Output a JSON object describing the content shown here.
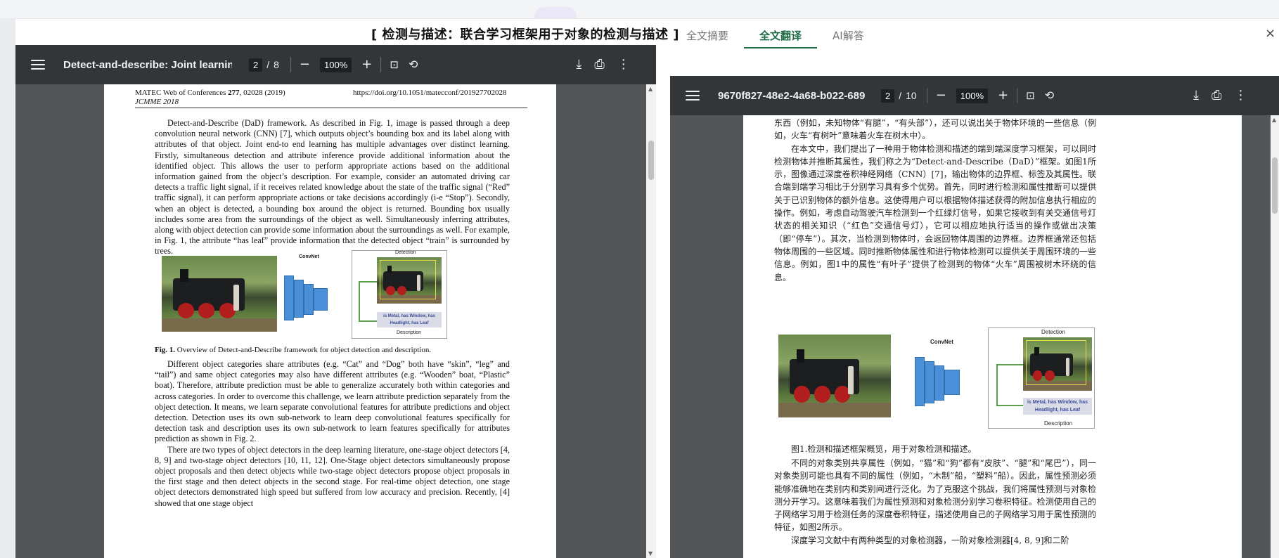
{
  "modal": {
    "title": "[ 检测与描述：联合学习框架用于对象的检测与描述 ]",
    "close": "×"
  },
  "left_viewer": {
    "doc_title": "Detect-and-describe: Joint learning...",
    "page_current": "2",
    "page_separator": "/",
    "page_total": "8",
    "zoom": "100%",
    "icons": [
      "menu-icon",
      "zoom-out-icon",
      "zoom-in-icon",
      "fit-page-icon",
      "rotate-icon",
      "download-icon",
      "print-icon",
      "more-icon"
    ],
    "page": {
      "header_left_pre": "MATEC Web of Conferences ",
      "header_left_bold": "277",
      "header_left_post": ", 02028 (2019)",
      "header_right": "https://doi.org/10.1051/matecconf/201927702028",
      "header_conf": "JCMME 2018",
      "paragraphs": [
        "Detect-and-Describe (DaD) framework. As described in Fig. 1, image is passed through a deep convolution neural network (CNN) [7], which outputs object’s bounding box and its label along with attributes of that object. Joint end-to end learning has multiple advantages over distinct learning. Firstly, simultaneous detection and attribute inference provide additional information about the identified object. This allows the user to perform appropriate actions based on the additional information gained from the object’s description. For example, consider an automated driving car detects a traffic light signal, if it receives related knowledge about the state of the traffic signal (“Red” traffic signal), it can perform appropriate actions or take decisions accordingly (i-e “Stop”). Secondly, when an object is detected, a bounding box around the object is returned. Bounding box usually includes some area from the surroundings of the object as well. Simultaneously inferring attributes, along with object detection can provide some information about the surroundings as well. For example, in Fig. 1, the attribute “has leaf” provide information that the detected object “train” is surrounded by trees.",
        "Different object categories share attributes (e.g. “Cat” and “Dog” both have “skin”, “leg” and “tail”) and same object categories may also have different attributes (e.g. “Wooden” boat, “Plastic” boat). Therefore, attribute prediction must be able to generalize accurately both within categories and across categories. In order to overcome this challenge, we learn attribute prediction separately from the object detection. It means, we learn separate convolutional features for attribute predictions and object detection. Detection uses its own sub-network to learn deep convolutional features specifically for detection task and description uses its own sub-network to learn features specifically for attributes prediction as shown in Fig. 2.",
        "There are two types of object detectors in the deep learning literature, one-stage object detectors [4, 8, 9] and two-stage object detectors [10, 11, 12]. One-Stage object detectors simultaneously propose object proposals and then detect objects while two-stage object detectors propose object proposals in the first stage and then detect objects in the second stage. For real-time object detection, one stage object detectors demonstrated high speed but suffered from low accuracy and precision. Recently, [4] showed that one stage object"
      ],
      "figure": {
        "convnet": "ConvNet",
        "detection": "Detection",
        "description_text": "is Metal, has Window, has Headlight, has Leaf",
        "description_label": "Description"
      },
      "caption_bold": "Fig. 1.",
      "caption_text": " Overview of Detect-and-Describe framework for object detection and description."
    }
  },
  "right_panel": {
    "tabs": [
      "全文摘要",
      "全文翻译",
      "AI解答"
    ],
    "active_tab": 1
  },
  "right_viewer": {
    "doc_title": "9670f827-48e2-4a68-b022-689...",
    "page_current": "2",
    "page_separator": "/",
    "page_total": "10",
    "zoom": "100%",
    "page": {
      "para1": "东西（例如，未知物体“有腿”，“有头部”），还可以说出关于物体环境的一些信息（例如，火车“有树叶”意味着火车在树木中）。",
      "para2": "在本文中，我们提出了一种用于物体检测和描述的端到端深度学习框架，可以同时检测物体并推断其属性，我们称之为“Detect-and-Describe（DaD）”框架。如图1所示，图像通过深度卷积神经网络（CNN）[7]，输出物体的边界框、标签及其属性。联合端到端学习相比于分别学习具有多个优势。首先，同时进行检测和属性推断可以提供关于已识别物体的额外信息。这使得用户可以根据物体描述获得的附加信息执行相应的操作。例如，考虑自动驾驶汽车检测到一个红绿灯信号，如果它接收到有关交通信号灯状态的相关知识（“红色”交通信号灯），它可以相应地执行适当的操作或做出决策（即“停车”）。其次，当检测到物体时，会返回物体周围的边界框。边界框通常还包括物体周围的一些区域。同时推断物体属性和进行物体检测可以提供关于周围环境的一些信息。例如，图1中的属性“有叶子”提供了检测到的物体“火车”周围被树木环绕的信息。",
      "figure": {
        "convnet": "ConvNet",
        "detection": "Detection",
        "description_text": "is Metal, has Window, has Headlight, has Leaf",
        "description_label": "Description"
      },
      "caption": "图1.检测和描述框架概览，用于对象检测和描述。",
      "para3": "不同的对象类别共享属性（例如，“猫”和“狗”都有“皮肤”、“腿”和“尾巴”），同一对象类别可能也具有不同的属性（例如，“木制”船，“塑料”船）。因此，属性预测必须能够准确地在类别内和类别间进行泛化。为了克服这个挑战，我们将属性预测与对象检测分开学习。这意味着我们为属性预测和对象检测分别学习卷积特征。检测使用自己的子网络学习用于检测任务的深度卷积特征，描述使用自己的子网络学习用于属性预测的特征，如图2所示。",
      "para4": "深度学习文献中有两种类型的对象检测器，一阶对象检测器[4, 8, 9]和二阶"
    }
  }
}
